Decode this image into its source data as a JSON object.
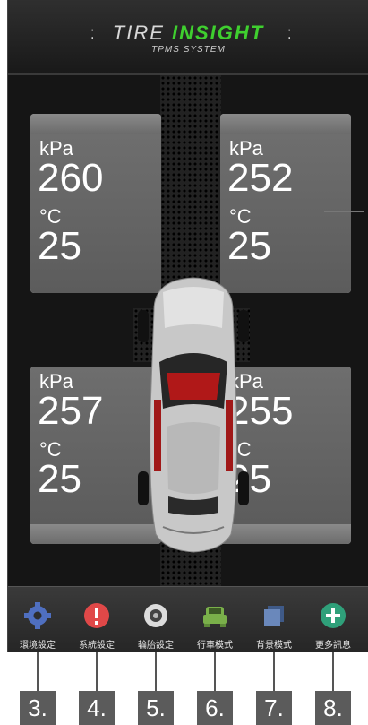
{
  "header": {
    "logo_main_a": "TIRE ",
    "logo_main_b": "INSIGHT",
    "logo_sub": "TPMS SYSTEM"
  },
  "tires": [
    {
      "id": "front-left",
      "pressure_unit": "kPa",
      "pressure": "260",
      "temp_unit": "°C",
      "temp": "25"
    },
    {
      "id": "front-right",
      "pressure_unit": "kPa",
      "pressure": "252",
      "temp_unit": "°C",
      "temp": "25"
    },
    {
      "id": "rear-left",
      "pressure_unit": "kPa",
      "pressure": "257",
      "temp_unit": "°C",
      "temp": "25"
    },
    {
      "id": "rear-right",
      "pressure_unit": "kPa",
      "pressure": "255",
      "temp_unit": "°C",
      "temp": "25"
    }
  ],
  "nav": [
    {
      "label": "環境設定",
      "icon": "gear-icon",
      "color": "#4f6fc0"
    },
    {
      "label": "系統設定",
      "icon": "alert-icon",
      "color": "#e04848"
    },
    {
      "label": "輪胎設定",
      "icon": "tire-icon",
      "color": "#d0d0d0"
    },
    {
      "label": "行車模式",
      "icon": "car-icon",
      "color": "#7ab04a"
    },
    {
      "label": "背景模式",
      "icon": "layers-icon",
      "color": "#5a78a8"
    },
    {
      "label": "更多訊息",
      "icon": "plus-icon",
      "color": "#2fa07a"
    }
  ],
  "callouts": [
    "3.",
    "4.",
    "5.",
    "6.",
    "7.",
    "8."
  ]
}
